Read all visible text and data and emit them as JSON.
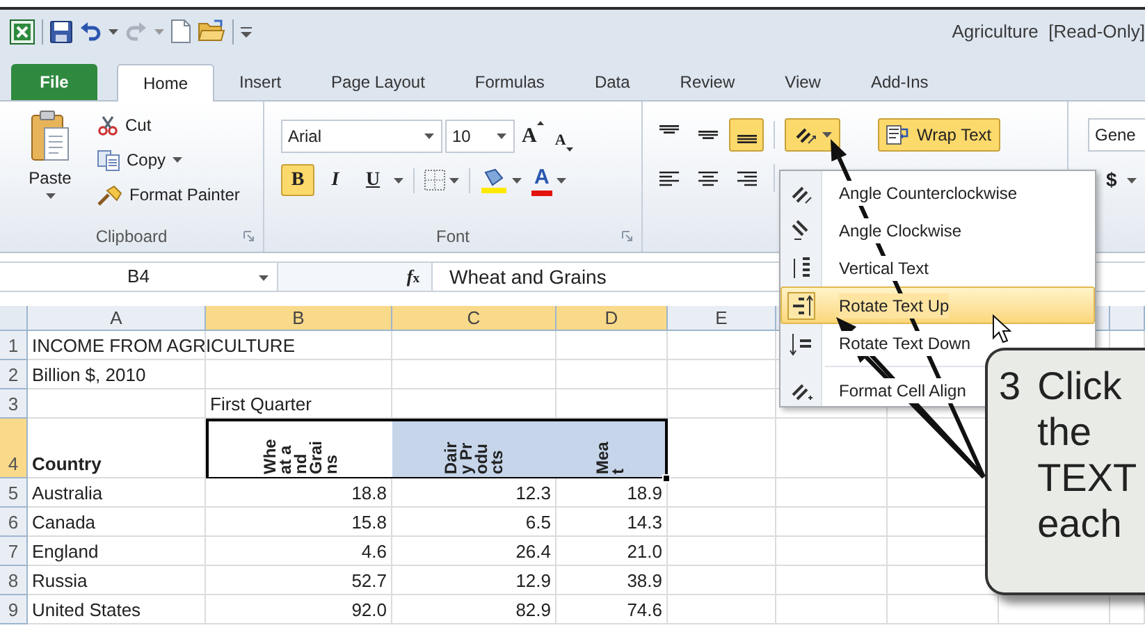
{
  "title_bar": {
    "title": "Agriculture  [Read-Only]"
  },
  "tabs": [
    {
      "label": "File",
      "kind": "file",
      "selected": false
    },
    {
      "label": "Home",
      "kind": "tab",
      "selected": true
    },
    {
      "label": "Insert",
      "kind": "tab",
      "selected": false
    },
    {
      "label": "Page Layout",
      "kind": "tab",
      "selected": false
    },
    {
      "label": "Formulas",
      "kind": "tab",
      "selected": false
    },
    {
      "label": "Data",
      "kind": "tab",
      "selected": false
    },
    {
      "label": "Review",
      "kind": "tab",
      "selected": false
    },
    {
      "label": "View",
      "kind": "tab",
      "selected": false
    },
    {
      "label": "Add-Ins",
      "kind": "tab",
      "selected": false
    }
  ],
  "clipboard": {
    "paste": "Paste",
    "actions": [
      {
        "label": "Cut",
        "kind": "cut",
        "has_menu": false
      },
      {
        "label": "Copy",
        "kind": "copy",
        "has_menu": true
      },
      {
        "label": "Format Painter",
        "kind": "painter",
        "has_menu": false
      }
    ],
    "group_label": "Clipboard"
  },
  "font": {
    "name": "Arial",
    "size": "10",
    "grow": "A",
    "shrink": "A",
    "styles": [
      {
        "label": "B",
        "kind": "bold",
        "selected": true
      },
      {
        "label": "I",
        "kind": "italic",
        "selected": false
      },
      {
        "label": "U",
        "kind": "underline",
        "selected": false
      }
    ],
    "font_color": "A",
    "group_label": "Font"
  },
  "alignment": {
    "vertical": [
      {
        "kind": "top",
        "selected": false
      },
      {
        "kind": "middle",
        "selected": false
      },
      {
        "kind": "bottom",
        "selected": true
      }
    ],
    "orientation_open": true,
    "wrap_text": {
      "label": "Wrap Text",
      "selected": true
    }
  },
  "number": {
    "format": "Gene",
    "currency": "$"
  },
  "orientation_menu": [
    {
      "label": "Angle Counterclockwise",
      "kind": "ccw",
      "selected": false
    },
    {
      "label": "Angle Clockwise",
      "kind": "cw",
      "selected": false
    },
    {
      "label": "Vertical Text",
      "kind": "vertical",
      "selected": false
    },
    {
      "label": "Rotate Text Up",
      "kind": "up",
      "selected": true
    },
    {
      "label": "Rotate Text Down",
      "kind": "down",
      "selected": false
    },
    {
      "label": "Format Cell Align",
      "kind": "format",
      "selected": false
    }
  ],
  "formula_bar": {
    "name_box": "B4",
    "fx": "*f*$_{x}$",
    "value": "Wheat and Grains"
  },
  "sheet": {
    "columns": [
      {
        "label": "A",
        "selected": false
      },
      {
        "label": "B",
        "selected": true
      },
      {
        "label": "C",
        "selected": true
      },
      {
        "label": "D",
        "selected": true
      },
      {
        "label": "E",
        "selected": false
      }
    ],
    "rows": [
      {
        "label": "1",
        "selected": false,
        "cells": [
          {
            "text": "INCOME FROM AGRICULTURE"
          }
        ]
      },
      {
        "label": "2",
        "selected": false,
        "cells": [
          {
            "text": "Billion $, 2010"
          }
        ]
      },
      {
        "label": "3",
        "selected": false,
        "cells": [
          {},
          {
            "text": "First Quarter"
          }
        ]
      },
      {
        "label": "4",
        "selected": true,
        "cells": [
          {
            "text": "Country",
            "kind": "heading"
          },
          {
            "text": "Wheat and Grains",
            "kind": "rotated",
            "active": true
          },
          {
            "text": "Dairy Products",
            "kind": "rotated",
            "active": false
          },
          {
            "text": "Meat",
            "kind": "rotated",
            "active": false
          }
        ]
      },
      {
        "label": "5",
        "selected": false,
        "cells": [
          {
            "text": "Australia"
          },
          {
            "text": "18.8",
            "kind": "number"
          },
          {
            "text": "12.3",
            "kind": "number"
          },
          {
            "text": "18.9",
            "kind": "number"
          }
        ]
      },
      {
        "label": "6",
        "selected": false,
        "cells": [
          {
            "text": "Canada"
          },
          {
            "text": "15.8",
            "kind": "number"
          },
          {
            "text": "6.5",
            "kind": "number"
          },
          {
            "text": "14.3",
            "kind": "number"
          }
        ]
      },
      {
        "label": "7",
        "selected": false,
        "cells": [
          {
            "text": "England"
          },
          {
            "text": "4.6",
            "kind": "number"
          },
          {
            "text": "26.4",
            "kind": "number"
          },
          {
            "text": "21.0",
            "kind": "number"
          }
        ]
      },
      {
        "label": "8",
        "selected": false,
        "cells": [
          {
            "text": "Russia"
          },
          {
            "text": "52.7",
            "kind": "number"
          },
          {
            "text": "12.9",
            "kind": "number"
          },
          {
            "text": "38.9",
            "kind": "number"
          }
        ]
      },
      {
        "label": "9",
        "selected": false,
        "cells": [
          {
            "text": "United States"
          },
          {
            "text": "92.0",
            "kind": "number"
          },
          {
            "text": "82.9",
            "kind": "number"
          },
          {
            "text": "74.6",
            "kind": "number"
          }
        ]
      }
    ]
  },
  "callout": {
    "number": "3",
    "lines": [
      "Click",
      "the",
      "TEXT",
      "each"
    ]
  }
}
